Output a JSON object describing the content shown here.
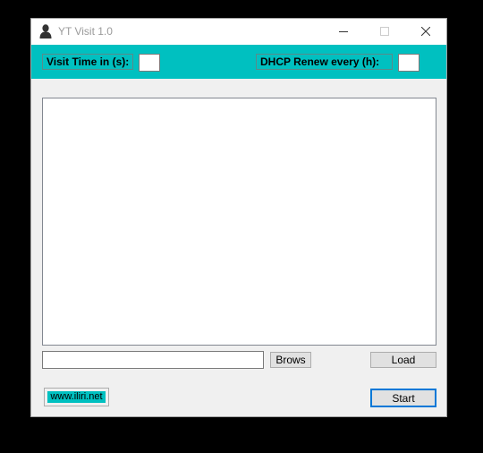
{
  "window": {
    "title": "YT Visit 1.0",
    "icon": "user-silhouette-icon"
  },
  "titlebar_buttons": {
    "minimize_icon": "minimize-icon",
    "maximize_icon": "maximize-icon",
    "close_icon": "close-icon"
  },
  "settings": {
    "visit_time_label": "Visit Time in (s):",
    "visit_time_value": "",
    "dhcp_renew_label": "DHCP Renew every (h):",
    "dhcp_renew_value": ""
  },
  "file": {
    "path_value": "",
    "browse_label": "Brows",
    "load_label": "Load"
  },
  "footer": {
    "website_link": "www.iliri.net",
    "start_label": "Start"
  },
  "colors": {
    "accent": "#00c0c0",
    "window_bg": "#f0f0f0",
    "focus_border": "#0078d7"
  }
}
